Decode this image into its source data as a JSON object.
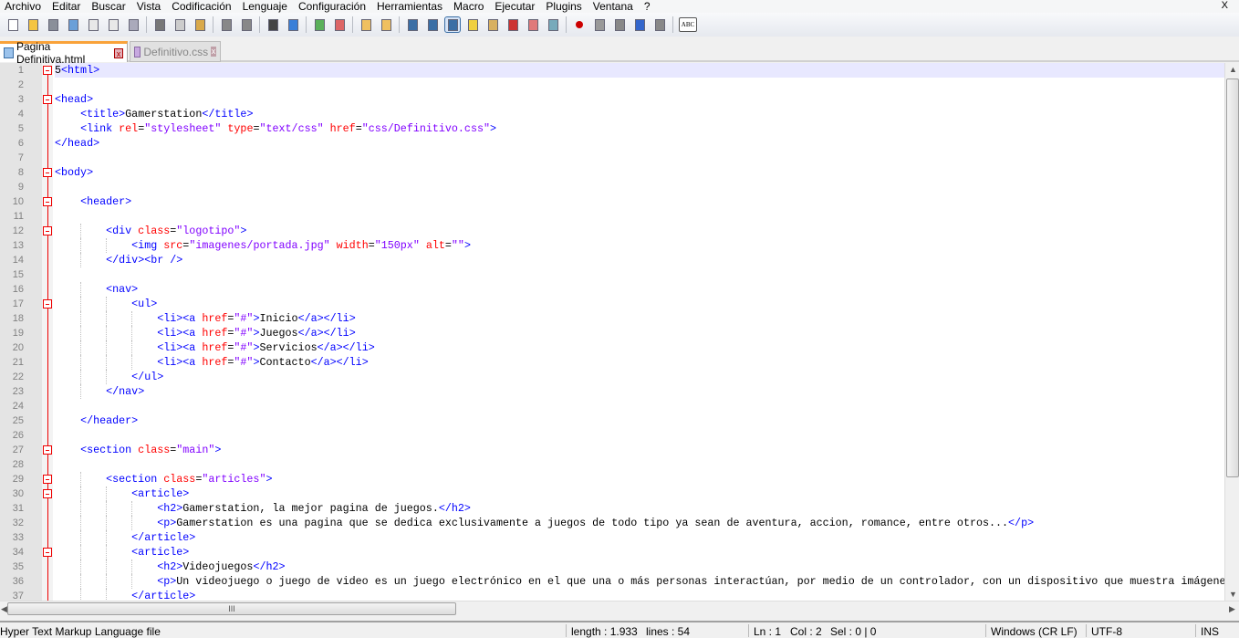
{
  "menu": [
    "Archivo",
    "Editar",
    "Buscar",
    "Vista",
    "Codificación",
    "Lenguaje",
    "Configuración",
    "Herramientas",
    "Macro",
    "Ejecutar",
    "Plugins",
    "Ventana",
    "?"
  ],
  "menu_close": "X",
  "toolbar": [
    "new-file",
    "open",
    "save",
    "save-all",
    "close",
    "close-all",
    "print",
    "|",
    "cut",
    "copy",
    "paste",
    "|",
    "undo",
    "redo",
    "|",
    "find",
    "replace",
    "|",
    "zoom-in",
    "zoom-out",
    "|",
    "sync-vertical",
    "sync-horizontal",
    "|",
    "word-wrap",
    "show-all-chars",
    "indent-guide",
    "user-defined-lang",
    "document-map",
    "function-list",
    "folder-workspace",
    "monitoring",
    "|",
    "record-macro",
    "stop-macro",
    "play-macro",
    "run-macro-multiple",
    "save-macro",
    "|",
    "spell-check"
  ],
  "spell_label": "ABC",
  "tabs": [
    {
      "label": "Pagina Definitiva.html",
      "active": true
    },
    {
      "label": "Definitivo.css",
      "active": false
    }
  ],
  "tab_close": "x",
  "lines": [
    "5<html>",
    "",
    "<head>",
    "    <title>Gamerstation</title>",
    "    <link rel=\"stylesheet\" type=\"text/css\" href=\"css/Definitivo.css\">",
    "</head>",
    "",
    "<body>",
    "",
    "    <header>",
    "",
    "        <div class=\"logotipo\">",
    "            <img src=\"imagenes/portada.jpg\" width=\"150px\" alt=\"\">",
    "        </div><br />",
    "",
    "        <nav>",
    "            <ul>",
    "                <li><a href=\"#\">Inicio</a></li>",
    "                <li><a href=\"#\">Juegos</a></li>",
    "                <li><a href=\"#\">Servicios</a></li>",
    "                <li><a href=\"#\">Contacto</a></li>",
    "            </ul>",
    "        </nav>",
    "",
    "    </header>",
    "",
    "    <section class=\"main\">",
    "",
    "        <section class=\"articles\">",
    "            <article>",
    "                <h2>Gamerstation, la mejor pagina de juegos.</h2>",
    "                <p>Gamerstation es una pagina que se dedica exclusivamente a juegos de todo tipo ya sean de aventura, accion, romance, entre otros...</p>",
    "            </article>",
    "            <article>",
    "                <h2>Videojuegos</h2>",
    "                <p>Un videojuego o juego de video es un juego electrónico en el que una o más personas interactúan, por medio de un controlador, con un dispositivo que muestra imágenes",
    "            </article>"
  ],
  "fold_open_lines": [
    1,
    3,
    8,
    10,
    12,
    17,
    27,
    29,
    30,
    34
  ],
  "current_line": 1,
  "hscroll_grip": "III",
  "status": {
    "filetype": "Hyper Text Markup Language file",
    "length": "length : 1.933",
    "lines": "lines : 54",
    "ln": "Ln : 1",
    "col": "Col : 2",
    "sel": "Sel : 0 | 0",
    "eol": "Windows (CR LF)",
    "encoding": "UTF-8",
    "mode": "INS"
  }
}
